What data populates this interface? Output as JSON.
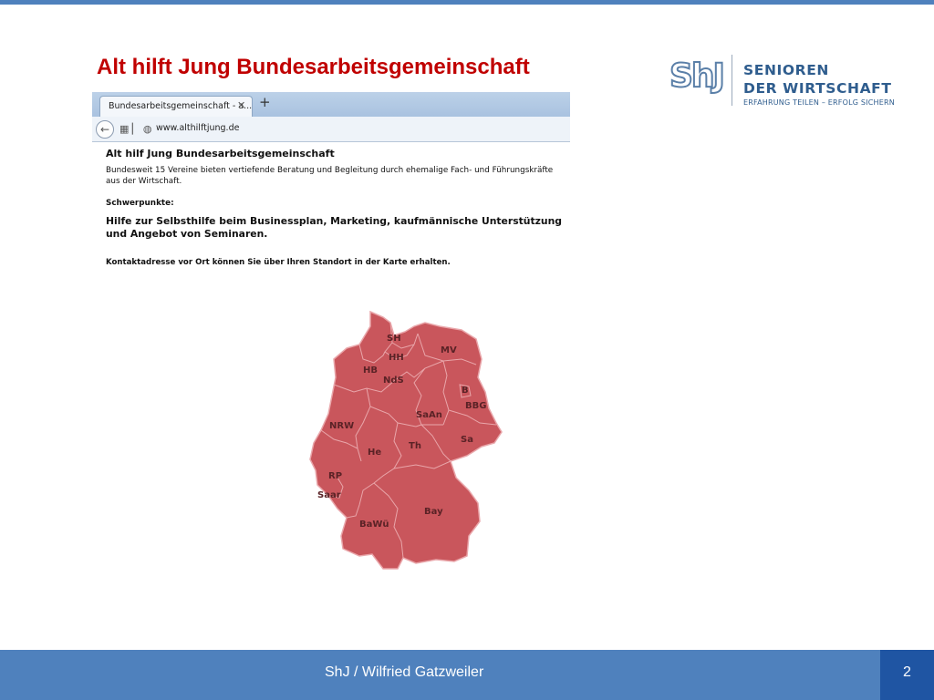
{
  "slide": {
    "title": "Alt hilft Jung Bundesarbeitsgemeinschaft"
  },
  "logo": {
    "mark": "ShJ",
    "line1": "SENIOREN",
    "line2": "DER WIRTSCHAFT",
    "tagline": "ERFAHRUNG TEILEN – ERFOLG SICHERN"
  },
  "browser": {
    "tab_title": "Bundesarbeitsgemeinschaft - a...",
    "tab_close": "✕",
    "new_tab": "+",
    "url": "www.althilftjung.de",
    "page": {
      "heading": "Alt hilf Jung Bundesarbeitsgemeinschaft",
      "body": "Bundesweit 15 Vereine bieten vertiefende Beratung und Begleitung durch ehemalige Fach- und Führungskräfte aus der Wirtschaft.",
      "focus_label": "Schwerpunkte:",
      "focus_text": "Hilfe zur Selbsthilfe beim Businessplan, Marketing, kaufmännische Unterstützung und Angebot von Seminaren.",
      "contact_text": "Kontaktadresse vor Ort können Sie über Ihren Standort in der Karte erhalten."
    }
  },
  "map": {
    "fill_color": "#c9565c",
    "border_color": "#e9a6aa",
    "regions": {
      "sh": "SH",
      "hh": "HH",
      "mv": "MV",
      "hb": "HB",
      "nds": "NdS",
      "b": "B",
      "bbg": "BBG",
      "saan": "SaAn",
      "nrw": "NRW",
      "sa": "Sa",
      "th": "Th",
      "he": "He",
      "rp": "RP",
      "saar": "Saar",
      "bay": "Bay",
      "bawu": "BaWü"
    }
  },
  "footer": {
    "text": "ShJ / Wilfried Gatzweiler",
    "page_number": "2"
  }
}
